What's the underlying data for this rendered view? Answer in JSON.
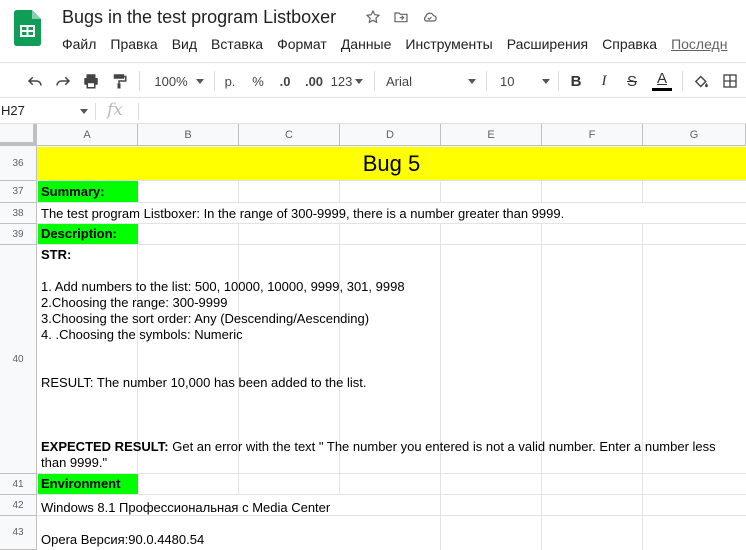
{
  "app": {
    "doc_title": "Bugs in the test program Listboxer",
    "menu": [
      "Файл",
      "Правка",
      "Вид",
      "Вставка",
      "Формат",
      "Данные",
      "Инструменты",
      "Расширения",
      "Справка",
      "Последн"
    ]
  },
  "toolbar": {
    "zoom": "100%",
    "currency": "р.",
    "percent": "%",
    "dec_decrease": ".0",
    "dec_increase": ".00",
    "more_formats": "123",
    "font": "Arial",
    "font_size": "10",
    "bold": "B",
    "italic": "I",
    "strike": "S",
    "text_color": "A",
    "text_color_value": "#000000"
  },
  "formula_bar": {
    "name_box": "H27",
    "fx_symbol": "fx",
    "content": ""
  },
  "grid": {
    "columns": [
      "A",
      "B",
      "C",
      "D",
      "E",
      "F",
      "G"
    ],
    "rows": [
      "36",
      "37",
      "38",
      "39",
      "40",
      "41",
      "42",
      "43"
    ],
    "banner": "Bug 5",
    "summary_label": "Summary:",
    "summary_text": "The test program Listboxer: In the range of 300-9999, there is a number greater than 9999.",
    "description_label": "Description:",
    "str_title": "STR:",
    "steps": [
      "1. Add numbers to the list: 500, 10000, 10000, 9999, 301, 9998",
      "2.Choosing the range: 300-9999",
      "3.Choosing the sort order:  Any (Descending/Aescending)",
      "4. .Choosing the symbols: Numeric"
    ],
    "result": "RESULT: The number 10,000 has been added to the list.",
    "expected_label": "EXPECTED RESULT:",
    "expected_text_line1": " Get an error with the text \" The number you entered is not a valid number. Enter a number less",
    "expected_text_line2": "than 9999.\"",
    "environment_label": "Environment",
    "env_os": "Windows 8.1 Профессиональная с  Media Center",
    "env_browser": "Opera  Версия:90.0.4480.54"
  },
  "colors": {
    "banner_yellow": "#ffff00",
    "label_green": "#00ff00",
    "sheets_green": "#0f9d58"
  }
}
